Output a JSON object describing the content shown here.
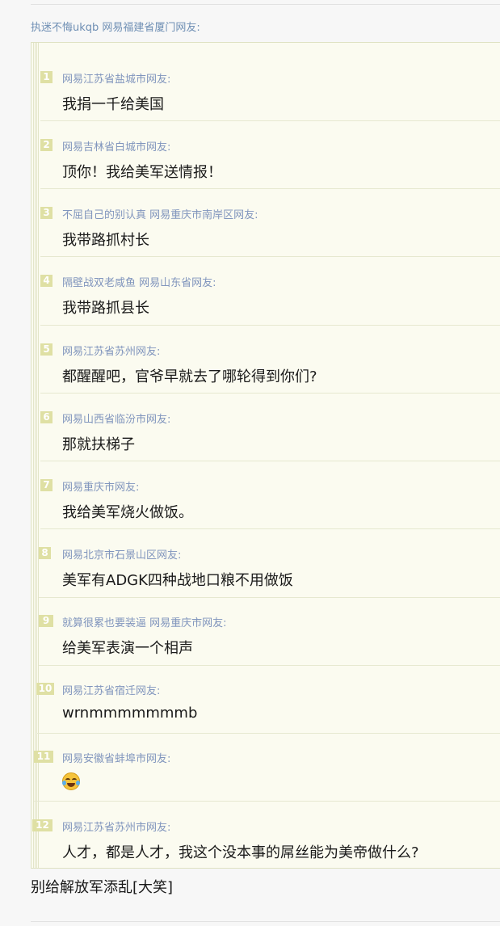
{
  "comment": {
    "author": "执迷不悔ukqb 网易福建省厦门网友:",
    "after_text": "别给解放军添乱[大笑]"
  },
  "floors": [
    {
      "num": "1",
      "author": "网易江苏省盐城市网友:",
      "text": "我捐一千给美国"
    },
    {
      "num": "2",
      "author": "网易吉林省白城市网友:",
      "text": "顶你！我给美军送情报！"
    },
    {
      "num": "3",
      "author": "不屈自己的别认真 网易重庆市南岸区网友:",
      "text": "我带路抓村长"
    },
    {
      "num": "4",
      "author": "隔壁战双老咸鱼 网易山东省网友:",
      "text": "我带路抓县长"
    },
    {
      "num": "5",
      "author": "网易江苏省苏州网友:",
      "text": "都醒醒吧，官爷早就去了哪轮得到你们?"
    },
    {
      "num": "6",
      "author": "网易山西省临汾市网友:",
      "text": "那就扶梯子"
    },
    {
      "num": "7",
      "author": "网易重庆市网友:",
      "text": "我给美军烧火做饭。"
    },
    {
      "num": "8",
      "author": "网易北京市石景山区网友:",
      "text": "美军有ADGK四种战地口粮不用做饭"
    },
    {
      "num": "9",
      "author": "就算很累也要装逼 网易重庆市网友:",
      "text": "给美军表演一个相声"
    },
    {
      "num": "10",
      "author": "网易江苏省宿迁网友:",
      "text": "wrnmmmmmmmb"
    },
    {
      "num": "11",
      "author": "网易安徽省蚌埠市网友:",
      "text": "",
      "emoji": "tears-of-joy-emoji"
    },
    {
      "num": "12",
      "author": "网易江苏省苏州市网友:",
      "text": "人才，都是人才，我这个没本事的屌丝能为美帝做什么?"
    }
  ]
}
